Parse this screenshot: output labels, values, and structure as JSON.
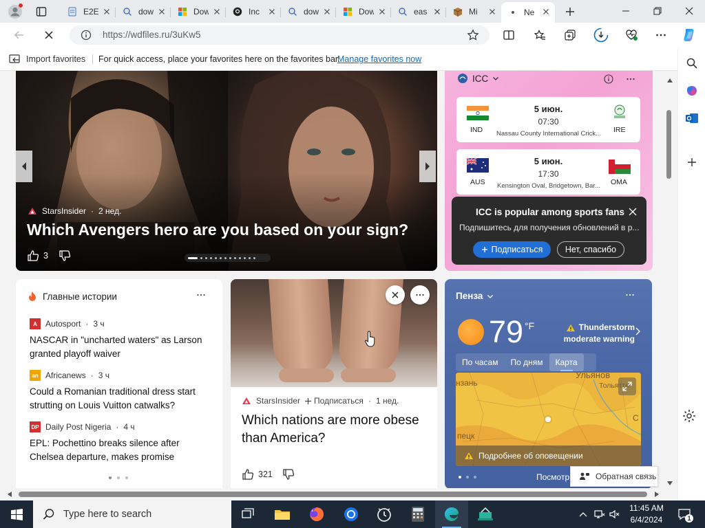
{
  "browser": {
    "tabs": [
      {
        "title": "E2E",
        "favicon": "page-icon"
      },
      {
        "title": "dow",
        "favicon": "search-icon"
      },
      {
        "title": "Dow",
        "favicon": "grid-icon"
      },
      {
        "title": "Inc",
        "favicon": "github-icon"
      },
      {
        "title": "dow",
        "favicon": "search-icon"
      },
      {
        "title": "Dow",
        "favicon": "grid-icon"
      },
      {
        "title": "eas",
        "favicon": "search-icon"
      },
      {
        "title": "Mi",
        "favicon": "box-icon"
      },
      {
        "title": "Ne",
        "favicon": "dot-icon",
        "active": true
      }
    ],
    "url": "https://wdfiles.ru/3uKw5",
    "favorites_bar": {
      "import_label": "Import favorites",
      "message": "For quick access, place your favorites here on the favorites bar.",
      "link": "Manage favorites now"
    }
  },
  "hero": {
    "source": "StarsInsider",
    "age": "2 нед.",
    "title": "Which Avengers hero are you based on your sign?",
    "likes": "3"
  },
  "icc": {
    "title": "ICC",
    "matches": [
      {
        "team1": "IND",
        "team2": "IRE",
        "date": "5 июн.",
        "time": "07:30",
        "venue": "Nassau County International Crick..."
      },
      {
        "team1": "AUS",
        "team2": "OMA",
        "date": "5 июн.",
        "time": "17:30",
        "venue": "Kensington Oval, Bridgetown, Bar..."
      }
    ],
    "popup": {
      "title": "ICC is popular among sports fans",
      "subtitle": "Подпишитесь для получения обновлений в р...",
      "subscribe": "Подписаться",
      "decline": "Нет, спасибо"
    }
  },
  "top_stories": {
    "title": "Главные истории",
    "items": [
      {
        "source": "Autosport",
        "age": "3 ч",
        "title": "NASCAR in \"uncharted waters\" as Larson granted playoff waiver",
        "logo": "A",
        "color": "#d32f2f"
      },
      {
        "source": "Africanews",
        "age": "3 ч",
        "title": "Could a Romanian traditional dress start strutting on Louis Vuitton catwalks?",
        "logo": "an",
        "color": "#f0a500"
      },
      {
        "source": "Daily Post Nigeria",
        "age": "4 ч",
        "title": "EPL: Pochettino breaks silence after Chelsea departure, makes promise",
        "logo": "DP",
        "color": "#d32f2f"
      }
    ]
  },
  "article": {
    "source": "StarsInsider",
    "follow": "Подписаться",
    "age": "1 нед.",
    "title": "Which nations are more obese than America?",
    "likes": "321"
  },
  "weather": {
    "city": "Пенза",
    "temp": "79",
    "unit": "°F",
    "warning_line1": "Thunderstorm",
    "warning_line2": "moderate warning",
    "tabs": [
      "По часам",
      "По дням",
      "Карта"
    ],
    "map_labels": {
      "left_top": "нзань",
      "right_top": "Ульянов",
      "right_mid": "Тольятти",
      "left_bottom": "пецк",
      "right_edge": "С"
    },
    "alert": "Подробнее об оповещении",
    "see_more": "Посмотр"
  },
  "feedback": "Обратная связь",
  "taskbar": {
    "search_placeholder": "Type here to search",
    "time": "11:45 AM",
    "date": "6/4/2024",
    "notifications": "1"
  },
  "colors": {
    "accent": "#0f6cbd",
    "subscribe": "#1f6fd6",
    "icc_bg": "#f3a2d4",
    "weather_bg": "#4b67a6",
    "taskbar": "#1c2836"
  }
}
